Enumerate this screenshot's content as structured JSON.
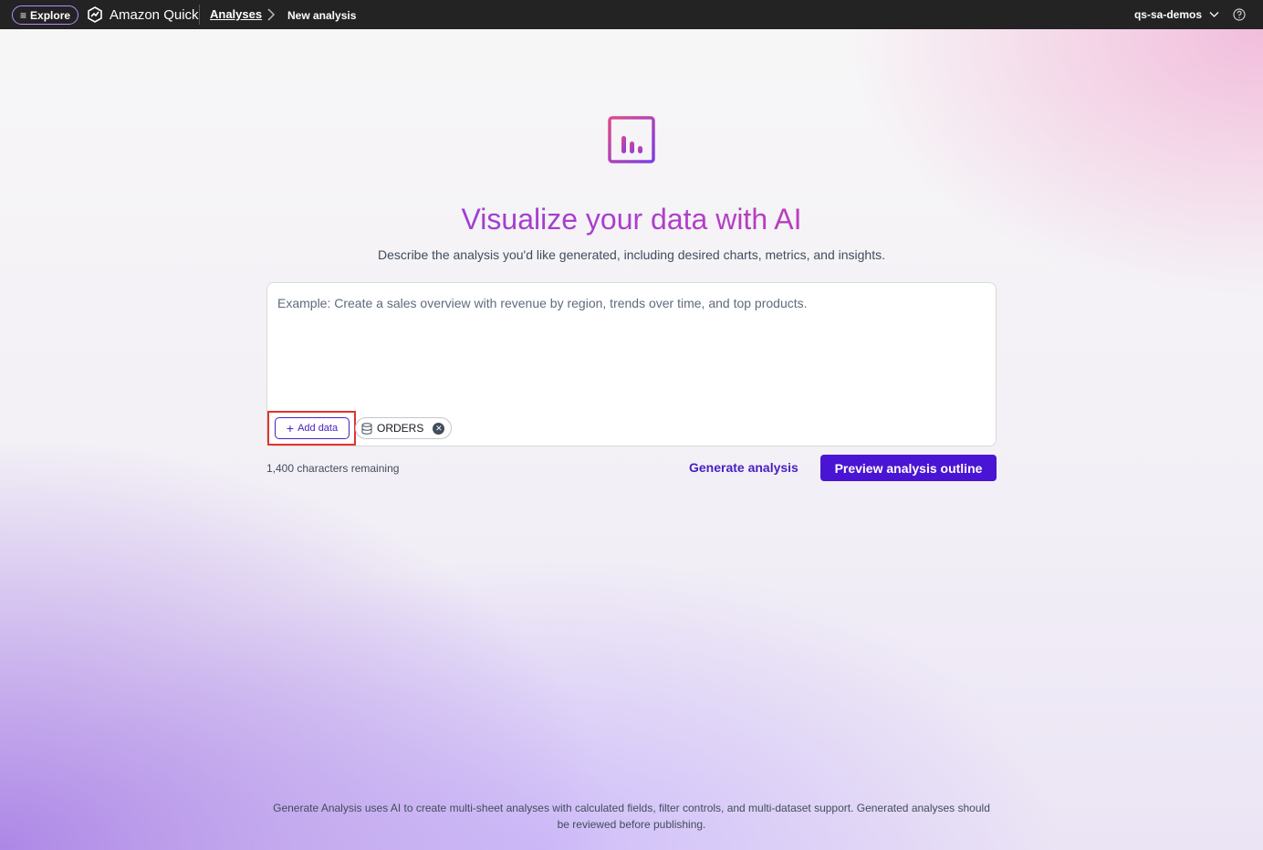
{
  "topbar": {
    "explore_label": "Explore",
    "brand_name": "Amazon Quick",
    "breadcrumb_parent": "Analyses",
    "breadcrumb_current": "New analysis",
    "account_name": "qs-sa-demos"
  },
  "hero": {
    "title": "Visualize your data with AI",
    "subtitle": "Describe the analysis you'd like generated, including desired charts, metrics, and insights."
  },
  "prompt": {
    "placeholder": "Example: Create a sales overview with revenue by region, trends over time, and top products.",
    "value": "",
    "add_data_label": "Add data",
    "dataset_chip": "ORDERS",
    "chars_remaining": "1,400 characters remaining"
  },
  "actions": {
    "generate_label": "Generate analysis",
    "preview_label": "Preview analysis outline"
  },
  "footer": {
    "note": "Generate Analysis uses AI to create multi-sheet analyses with calculated fields, filter controls, and multi-dataset support. Generated analyses should be reviewed before publishing."
  },
  "colors": {
    "accent": "#4a14d4",
    "highlight": "#e0352b",
    "topbar": "#232323"
  },
  "icons": [
    "menu-icon",
    "amazon-quick-logo-icon",
    "chevron-right-icon",
    "chevron-down-icon",
    "help-icon",
    "chart-window-icon",
    "plus-icon",
    "database-icon",
    "close-icon"
  ]
}
